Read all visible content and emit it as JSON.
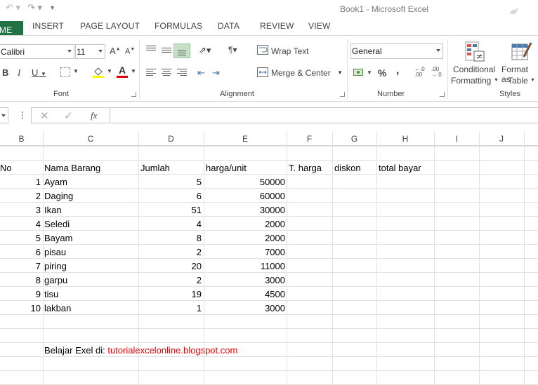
{
  "window": {
    "title": "Book1 - Microsoft Excel"
  },
  "tabs": [
    "ME",
    "INSERT",
    "PAGE LAYOUT",
    "FORMULAS",
    "DATA",
    "REVIEW",
    "VIEW"
  ],
  "ribbon": {
    "font": {
      "name": "Calibri",
      "size": "11",
      "group_label": "Font"
    },
    "alignment": {
      "wrap_text": "Wrap Text",
      "merge_center": "Merge & Center",
      "group_label": "Alignment"
    },
    "number": {
      "format": "General",
      "percent": "%",
      "comma": ",",
      "group_label": "Number"
    },
    "styles": {
      "conditional_1": "Conditional",
      "conditional_2": "Formatting",
      "format_as_1": "Format as",
      "format_as_2": "Table",
      "group_label": "Styles"
    }
  },
  "formula_bar": {
    "fx": "fx",
    "value": ""
  },
  "columns": [
    "B",
    "C",
    "D",
    "E",
    "F",
    "G",
    "H",
    "I",
    "J"
  ],
  "sheet": {
    "headers": {
      "no": "No",
      "nama": "Nama Barang",
      "jumlah": "Jumlah",
      "harga": "harga/unit",
      "t_harga": "T. harga",
      "diskon": "diskon",
      "total": "total bayar"
    },
    "rows": [
      {
        "no": "1",
        "nama": "Ayam",
        "jumlah": "5",
        "harga": "50000"
      },
      {
        "no": "2",
        "nama": "Daging",
        "jumlah": "6",
        "harga": "60000"
      },
      {
        "no": "3",
        "nama": "Ikan",
        "jumlah": "51",
        "harga": "30000"
      },
      {
        "no": "4",
        "nama": "Seledi",
        "jumlah": "4",
        "harga": "2000"
      },
      {
        "no": "5",
        "nama": "Bayam",
        "jumlah": "8",
        "harga": "2000"
      },
      {
        "no": "6",
        "nama": "pisau",
        "jumlah": "2",
        "harga": "7000"
      },
      {
        "no": "7",
        "nama": "piring",
        "jumlah": "20",
        "harga": "11000"
      },
      {
        "no": "8",
        "nama": "garpu",
        "jumlah": "2",
        "harga": "3000"
      },
      {
        "no": "9",
        "nama": "tisu",
        "jumlah": "19",
        "harga": "4500"
      },
      {
        "no": "10",
        "nama": "lakban",
        "jumlah": "1",
        "harga": "3000"
      }
    ],
    "footer_label": "Belajar Exel di: ",
    "footer_link": "tutorialexcelonline.blogspot.com"
  },
  "colors": {
    "accent": "#217346",
    "link": "#e00000",
    "fill_yellow": "#ffff00",
    "font_red": "#e00000"
  }
}
